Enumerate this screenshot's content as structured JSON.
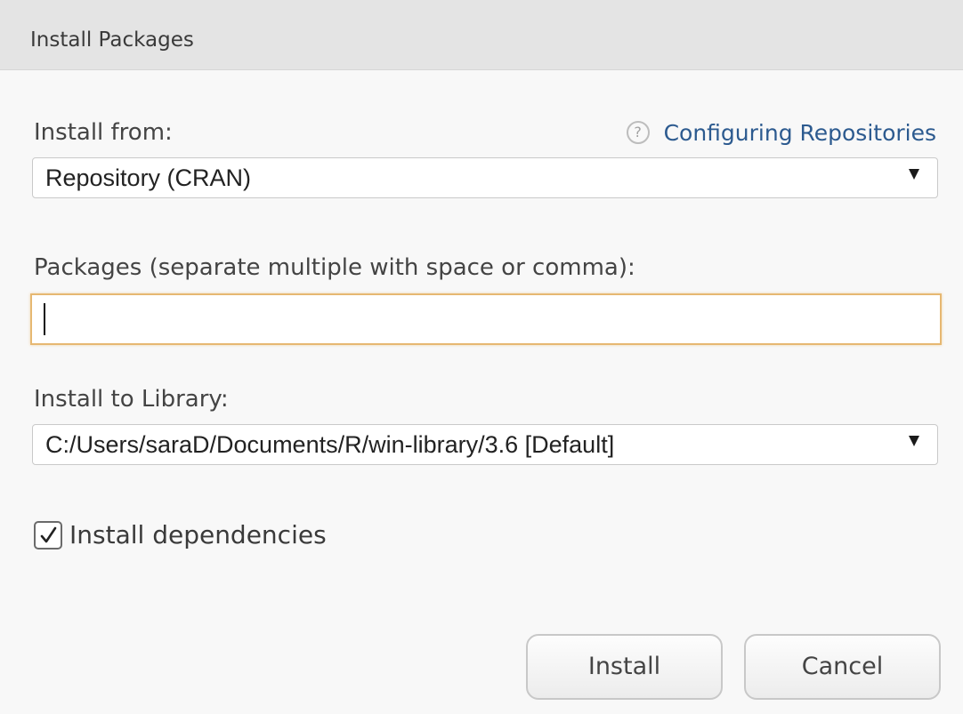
{
  "dialog": {
    "title": "Install Packages"
  },
  "install_from": {
    "label": "Install from:",
    "help_link": "Configuring Repositories",
    "help_icon": "question-circle-icon",
    "selected": "Repository (CRAN)"
  },
  "packages": {
    "label": "Packages (separate multiple with space or comma):",
    "value": ""
  },
  "library": {
    "label": "Install to Library:",
    "selected": "C:/Users/saraD/Documents/R/win-library/3.6 [Default]"
  },
  "dependencies": {
    "label": "Install dependencies",
    "checked": true
  },
  "buttons": {
    "install": "Install",
    "cancel": "Cancel"
  },
  "colors": {
    "link": "#2c5a8f",
    "focus_border": "#e6b872",
    "titlebar": "#e4e4e4"
  }
}
